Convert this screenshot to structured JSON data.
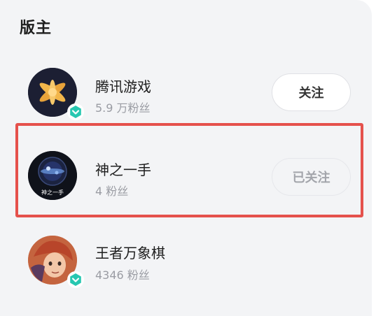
{
  "section": {
    "title": "版主"
  },
  "moderators": [
    {
      "name": "腾讯游戏",
      "fans": "5.9 万粉丝",
      "button": "关注",
      "verified": true,
      "followed": false
    },
    {
      "name": "神之一手",
      "fans": "4 粉丝",
      "button": "已关注",
      "verified": false,
      "followed": true,
      "avatar_text": "神之一手"
    },
    {
      "name": "王者万象棋",
      "fans": "4346 粉丝",
      "button": "",
      "verified": true,
      "followed": false
    }
  ],
  "colors": {
    "background": "#f3f4f6",
    "verified_badge": "#27c7b1",
    "highlight_border": "#e5514c",
    "text_primary": "#1e1e1e",
    "text_secondary": "#9a9ca3"
  }
}
